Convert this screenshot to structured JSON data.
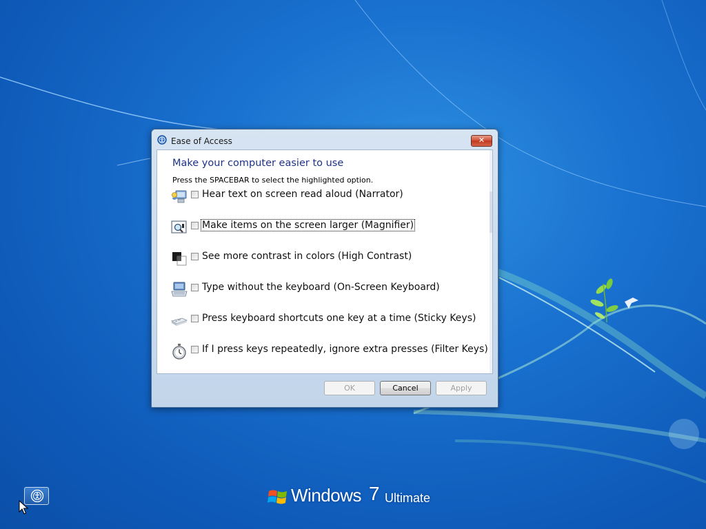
{
  "dialog": {
    "title": "Ease of Access",
    "close_label": "✕",
    "heading": "Make your computer easier to use",
    "subheading": "Press the SPACEBAR to select the highlighted option.",
    "options": [
      {
        "label": "Hear text on screen read aloud (Narrator)",
        "icon": "narrator-icon",
        "checked": false
      },
      {
        "label": "Make items on the screen larger (Magnifier)",
        "icon": "magnifier-icon",
        "checked": false,
        "focused": true
      },
      {
        "label": "See more contrast in colors (High Contrast)",
        "icon": "high-contrast-icon",
        "checked": false
      },
      {
        "label": "Type without the keyboard (On-Screen Keyboard)",
        "icon": "on-screen-keyboard-icon",
        "checked": false
      },
      {
        "label": "Press keyboard shortcuts one key at a time (Sticky Keys)",
        "icon": "sticky-keys-icon",
        "checked": false
      },
      {
        "label": "If I press keys repeatedly, ignore extra presses (Filter Keys)",
        "icon": "filter-keys-icon",
        "checked": false
      }
    ],
    "buttons": {
      "ok": "OK",
      "cancel": "Cancel",
      "apply": "Apply"
    }
  },
  "desktop": {
    "ease_of_access_button_icon": "ease-of-access-icon"
  },
  "branding": {
    "windows": "Windows",
    "version": "7",
    "edition": "Ultimate"
  },
  "colors": {
    "heading": "#1e3287",
    "wallpaper": "#1a72d0",
    "close_button": "#c0391e"
  }
}
